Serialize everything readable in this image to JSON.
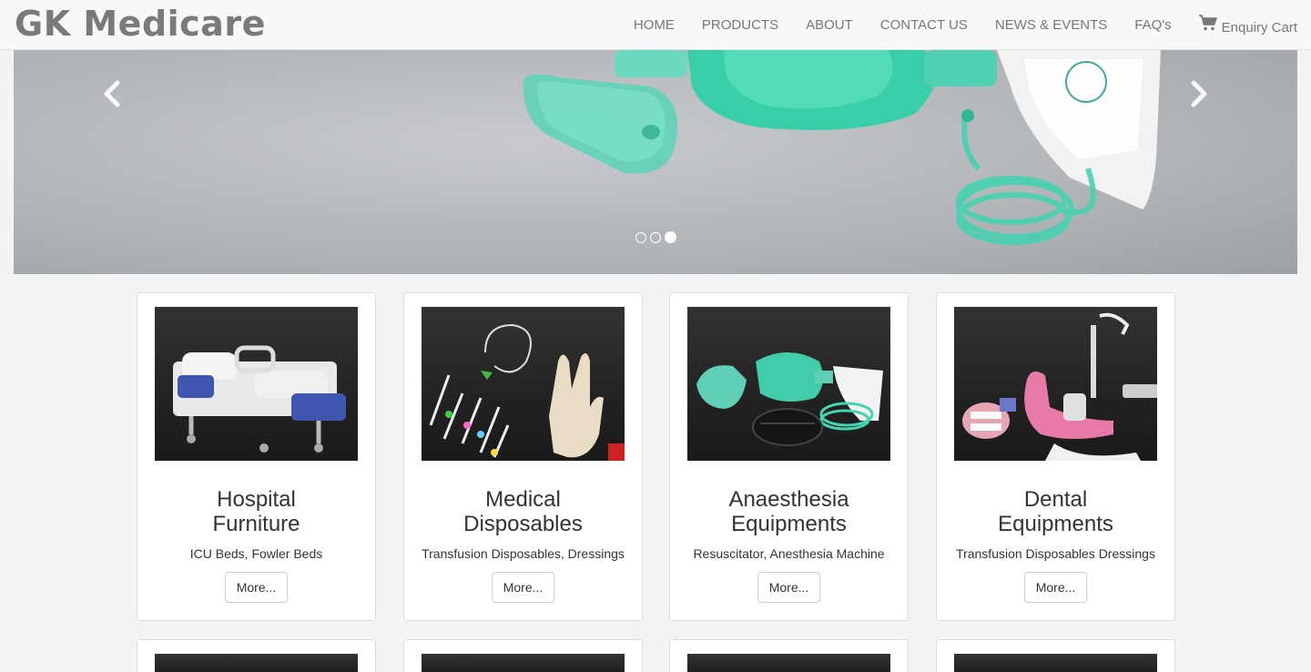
{
  "brand": "GK Medicare",
  "nav": {
    "home": "HOME",
    "products": "PRODUCTS",
    "about": "ABOUT",
    "contact": "CONTACT US",
    "news": "NEWS & EVENTS",
    "faq": "FAQ's",
    "cart": "Enquiry Cart",
    "cart_icon": "shopping-cart-icon"
  },
  "carousel": {
    "prev_icon": "chevron-left-icon",
    "next_icon": "chevron-right-icon",
    "slide_count": 3,
    "active_slide": 3
  },
  "products": [
    {
      "title_line1": "Hospital",
      "title_line2": "Furniture",
      "subtitle": "ICU Beds, Fowler Beds",
      "button": "More..."
    },
    {
      "title_line1": "Medical",
      "title_line2": "Disposables",
      "subtitle": "Transfusion Disposables, Dressings",
      "button": "More..."
    },
    {
      "title_line1": "Anaesthesia",
      "title_line2": "Equipments",
      "subtitle": "Resuscitator, Anesthesia Machine",
      "button": "More..."
    },
    {
      "title_line1": "Dental",
      "title_line2": "Equipments",
      "subtitle": "Transfusion Disposables Dressings",
      "button": "More..."
    }
  ],
  "colors": {
    "navbar_bg": "#f8f8f8",
    "brand_text": "#7a7a7a",
    "page_bg": "#f3f3f3",
    "accent_mint": "#4fd9bb"
  }
}
